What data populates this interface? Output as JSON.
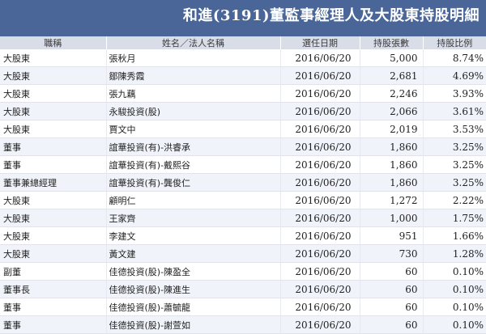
{
  "header": {
    "title": "和進(3191)董監事經理人及大股東持股明細"
  },
  "table": {
    "columns": [
      "職稱",
      "姓名／法人名稱",
      "選任日期",
      "持股張數",
      "持股比例"
    ],
    "rows": [
      [
        "大股東",
        "張秋月",
        "2016/06/20",
        "5,000",
        "8.74%"
      ],
      [
        "大股東",
        "鄒陳秀霞",
        "2016/06/20",
        "2,681",
        "4.69%"
      ],
      [
        "大股東",
        "張九藕",
        "2016/06/20",
        "2,246",
        "3.93%"
      ],
      [
        "大股東",
        "永駿投資(股)",
        "2016/06/20",
        "2,066",
        "3.61%"
      ],
      [
        "大股東",
        "賈文中",
        "2016/06/20",
        "2,019",
        "3.53%"
      ],
      [
        "董事",
        "誼華投資(有)-洪睿承",
        "2016/06/20",
        "1,860",
        "3.25%"
      ],
      [
        "董事",
        "誼華投資(有)-戴熙谷",
        "2016/06/20",
        "1,860",
        "3.25%"
      ],
      [
        "董事兼總經理",
        "誼華投資(有)-龔俊仁",
        "2016/06/20",
        "1,860",
        "3.25%"
      ],
      [
        "大股東",
        "顧明仁",
        "2016/06/20",
        "1,272",
        "2.22%"
      ],
      [
        "大股東",
        "王家齊",
        "2016/06/20",
        "1,000",
        "1.75%"
      ],
      [
        "大股東",
        "李建文",
        "2016/06/20",
        "951",
        "1.66%"
      ],
      [
        "大股東",
        "黃文建",
        "2016/06/20",
        "730",
        "1.28%"
      ],
      [
        "副董",
        "佳德投資(股)-陳盈全",
        "2016/06/20",
        "60",
        "0.10%"
      ],
      [
        "董事長",
        "佳德投資(股)-陳進生",
        "2016/06/20",
        "60",
        "0.10%"
      ],
      [
        "董事",
        "佳德投資(股)-蕭毓龍",
        "2016/06/20",
        "60",
        "0.10%"
      ],
      [
        "董事",
        "佳德投資(股)-謝萱如",
        "2016/06/20",
        "60",
        "0.10%"
      ]
    ]
  }
}
